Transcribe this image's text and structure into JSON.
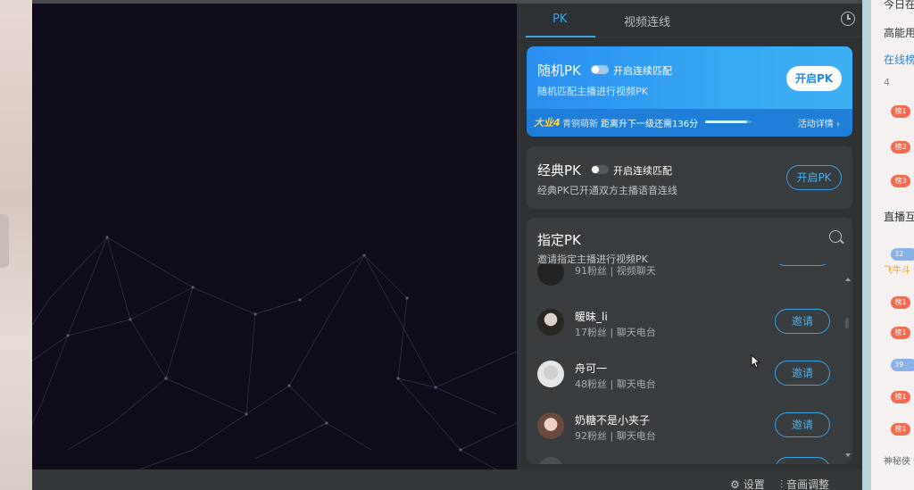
{
  "background": {
    "right_column": {
      "rows": [
        "今日在",
        "高能用",
        "在线榜",
        "4",
        "直播互",
        "32",
        "飞牛斗",
        "39",
        "神秘侠"
      ],
      "badges": [
        "榜1",
        "榜2",
        "榜3",
        "榜1",
        "榜1",
        "榜1",
        "榜1"
      ]
    }
  },
  "tabs": {
    "pk": "PK",
    "video_link": "视频连线"
  },
  "random_pk": {
    "title": "随机PK",
    "toggle_label": "开启连续匹配",
    "subtitle": "随机匹配主播进行视频PK",
    "button": "开启PK",
    "level_badge": "大业4",
    "rank_text": "青铜萌新",
    "progress_text": "距离升下一级还需136分",
    "progress_fraction": 0.9,
    "details_link": "活动详情 ›"
  },
  "classic_pk": {
    "title": "经典PK",
    "toggle_label": "开启连续匹配",
    "subtitle": "经典PK已开通双方主播语音连线",
    "button": "开启PK"
  },
  "designated_pk": {
    "title": "指定PK",
    "subtitle": "邀请指定主播进行视频PK",
    "partial_top": {
      "meta": "91粉丝 | 视频聊天"
    },
    "items": [
      {
        "name": "暖昧_li",
        "meta": "17粉丝 | 聊天电台",
        "button": "邀请"
      },
      {
        "name": "舟可一",
        "meta": "48粉丝 | 聊天电台",
        "button": "邀请"
      },
      {
        "name": "奶糖不是小夹子",
        "meta": "92粉丝 | 聊天电台",
        "button": "邀请"
      }
    ]
  },
  "bottom_bar": {
    "settings": "设置",
    "audio": "音画调整"
  },
  "colors": {
    "accent": "#3aa7e8",
    "panel_bg": "#2f3234",
    "card_bg": "#3a3d40"
  }
}
